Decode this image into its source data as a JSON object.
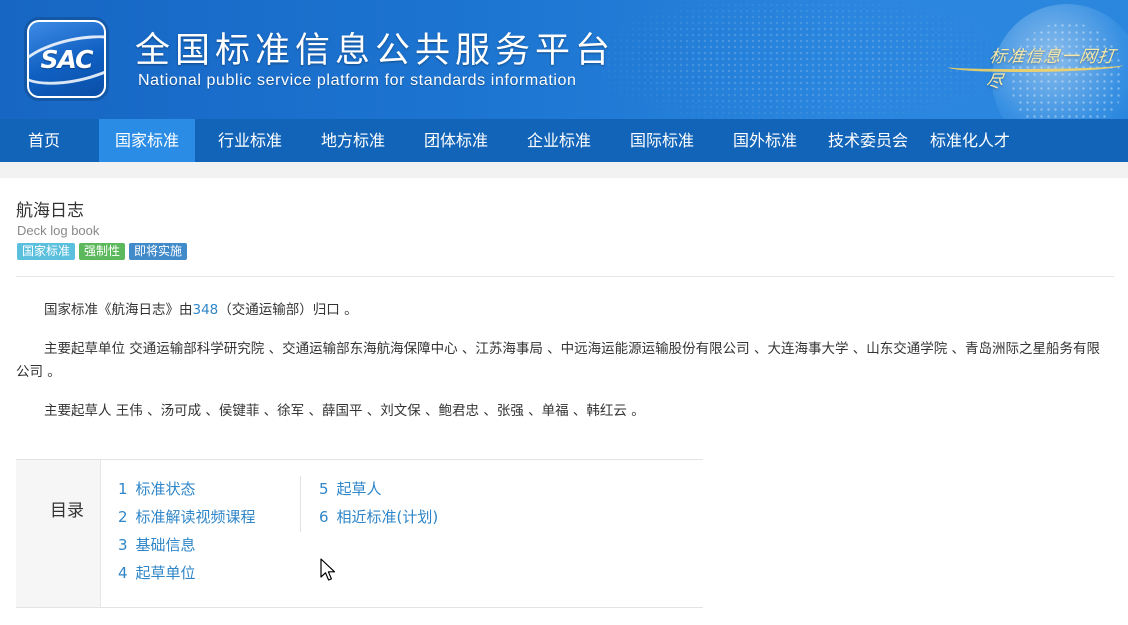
{
  "header": {
    "logo_text": "SAC",
    "title": "全国标准信息公共服务平台",
    "subtitle": "National public service platform  for standards information",
    "slogan": "标准信息一网打尽"
  },
  "nav": {
    "items": [
      {
        "label": "首页",
        "active": false
      },
      {
        "label": "国家标准",
        "active": true
      },
      {
        "label": "行业标准",
        "active": false
      },
      {
        "label": "地方标准",
        "active": false
      },
      {
        "label": "团体标准",
        "active": false
      },
      {
        "label": "企业标准",
        "active": false
      },
      {
        "label": "国际标准",
        "active": false
      },
      {
        "label": "国外标准",
        "active": false
      },
      {
        "label": "技术委员会",
        "active": false
      },
      {
        "label": "标准化人才",
        "active": false
      }
    ]
  },
  "standard": {
    "title": "航海日志",
    "title_en": "Deck log book",
    "badges": [
      {
        "label": "国家标准",
        "color": "#5bc0de"
      },
      {
        "label": "强制性",
        "color": "#5cb85c"
      },
      {
        "label": "即将实施",
        "color": "#428bca"
      }
    ],
    "attribution": {
      "prefix": "国家标准《航海日志》由",
      "tc_code": "348",
      "suffix": "（交通运输部）归口 。"
    },
    "drafting_units": {
      "label": "主要起草单位",
      "text": "交通运输部科学研究院 、交通运输部东海航海保障中心 、江苏海事局 、中远海运能源运输股份有限公司 、大连海事大学 、山东交通学院 、青岛洲际之星船务有限公司 。"
    },
    "drafters": {
      "label": "主要起草人",
      "text": "王伟 、汤可成 、侯键菲 、徐军 、薛国平 、刘文保 、鲍君忠 、张强 、单福 、韩红云 。"
    }
  },
  "toc": {
    "label": "目录",
    "items": [
      {
        "num": "1",
        "label": "标准状态"
      },
      {
        "num": "2",
        "label": "标准解读视频课程"
      },
      {
        "num": "3",
        "label": "基础信息"
      },
      {
        "num": "4",
        "label": "起草单位"
      },
      {
        "num": "5",
        "label": "起草人"
      },
      {
        "num": "6",
        "label": "相近标准(计划)"
      }
    ]
  }
}
